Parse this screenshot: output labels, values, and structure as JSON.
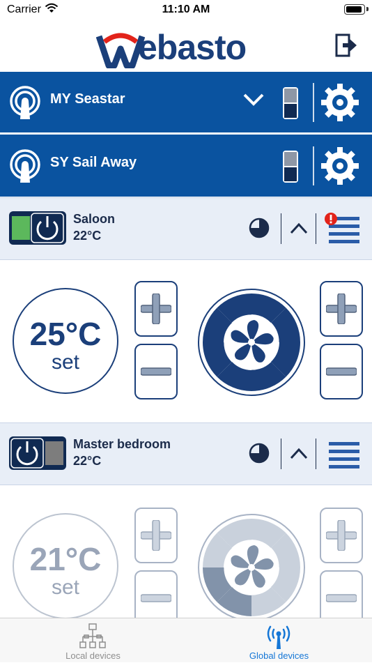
{
  "status": {
    "carrier": "Carrier",
    "time": "11:10 AM"
  },
  "brand": {
    "logo_text": "ebasto"
  },
  "devices": [
    {
      "name": "MY Seastar"
    },
    {
      "name": "SY Sail Away"
    }
  ],
  "zones": [
    {
      "name": "Saloon",
      "temperature": "22°C",
      "setpoint": "25°C",
      "set_label": "set"
    },
    {
      "name": "Master bedroom",
      "temperature": "22°C",
      "setpoint": "21°C",
      "set_label": "set"
    }
  ],
  "tabs": [
    {
      "label": "Local devices"
    },
    {
      "label": "Global devices"
    }
  ],
  "colors": {
    "header_blue": "#0a53a0",
    "dark_navy": "#1b3f7a",
    "brand_red": "#e2231a",
    "active_tab": "#1476d6",
    "zone_bg": "#e8eef7"
  },
  "icons": [
    "wifi-icon",
    "battery-icon",
    "logout-icon",
    "antenna-icon",
    "chevron-down-icon",
    "toggle-icon",
    "gear-icon",
    "power-icon",
    "clock-icon",
    "chevron-up-icon",
    "menu-icon",
    "alert-icon",
    "plus-icon",
    "minus-icon",
    "fan-icon",
    "network-icon"
  ]
}
